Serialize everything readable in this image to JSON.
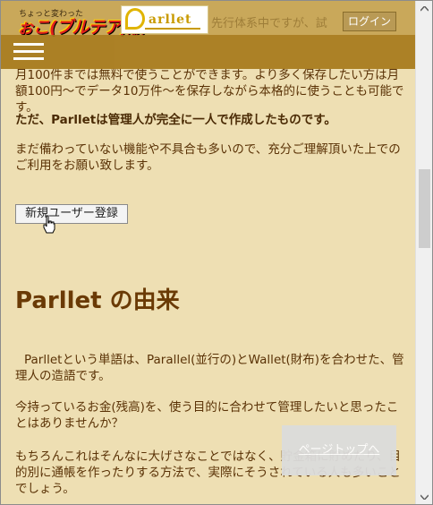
{
  "header": {
    "logo_small_text": "ちょっと変わった",
    "logo_main_text": "ぉこ(ブルテア)版",
    "logo_badge_text": "arllet",
    "login_label": "ログイン",
    "ghost_header_text": "先行体系中ですが、試"
  },
  "nav": {
    "ghost_text": "月100件までは無料で使うことができます。より多く保存したい"
  },
  "intro": {
    "para1": "月100件までは無料で使うことができます。より多く保存したい方は月額100円〜でデータ10万件〜を保存しながら本格的に使うことも可能です。",
    "para2": "ただ、Parlletは管理人が完全に一人で作成したものです。",
    "para3": "まだ備わっていない機能や不具合も多いので、充分ご理解頂いた上でのご利用をお願い致します。",
    "signup_label": "新規ユーザー登録"
  },
  "origin": {
    "heading": "Parllet の由来",
    "para1": "Parlletという単語は、Parallel(並行の)とWallet(財布)を合わせた、管理人の造語です。",
    "para2": "今持っているお金(残高)を、使う目的に合わせて管理したいと思ったことはありませんか？",
    "para3": "もちろんこれはそんなに大げさなことではなく、貯金箱に貯めたり、目的別に通帳を作ったりする方法で、実際にそうされている人も多いことでしょう。"
  },
  "page_top_label": "ページトップへ",
  "icons": {
    "menu": "hamburger-menu-icon",
    "cursor": "hand-cursor-icon",
    "scroll_up": "chevron-up-icon",
    "scroll_down": "chevron-down-icon"
  },
  "colors": {
    "background": "#eedfb3",
    "header": "#c9a85a",
    "navbar": "#a6781a",
    "text": "#5a3206",
    "heading": "#6a3a05"
  }
}
